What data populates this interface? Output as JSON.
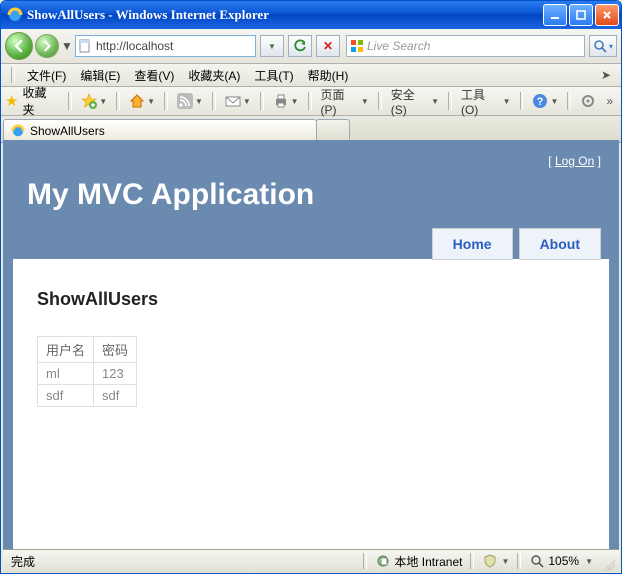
{
  "window": {
    "title": "ShowAllUsers - Windows Internet Explorer"
  },
  "address": {
    "url": "http://localhost"
  },
  "search": {
    "placeholder": "Live Search"
  },
  "menus": {
    "file": "文件(F)",
    "edit": "编辑(E)",
    "view": "查看(V)",
    "fav": "收藏夹(A)",
    "tools": "工具(T)",
    "help": "帮助(H)"
  },
  "favbar": {
    "label": "收藏夹",
    "page": "页面(P)",
    "safety": "安全(S)",
    "tools": "工具(O)"
  },
  "tab": {
    "title": "ShowAllUsers"
  },
  "page": {
    "logon": "Log On",
    "title": "My MVC Application",
    "nav_home": "Home",
    "nav_about": "About",
    "heading": "ShowAllUsers",
    "col_user": "用户名",
    "col_pwd": "密码",
    "rows": [
      {
        "user": "ml",
        "pwd": "123"
      },
      {
        "user": "sdf",
        "pwd": "sdf"
      }
    ]
  },
  "status": {
    "done": "完成",
    "zone": "本地 Intranet",
    "zoom": "105%"
  }
}
